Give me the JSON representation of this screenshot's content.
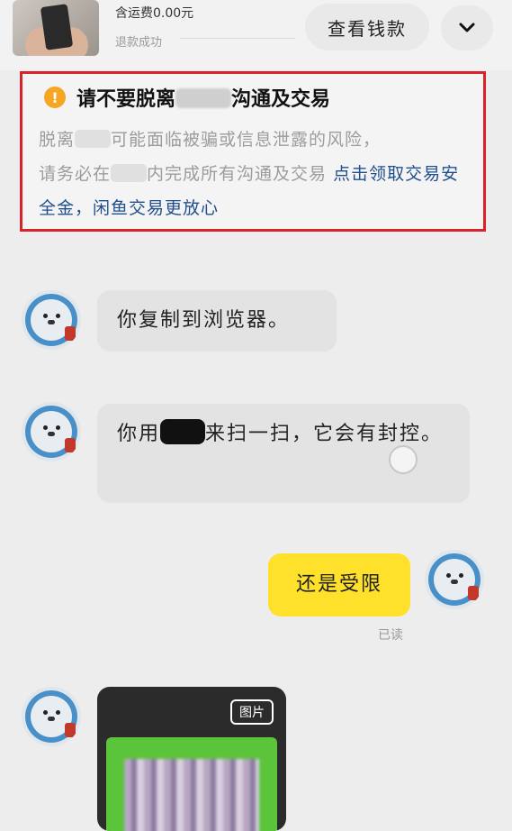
{
  "order": {
    "price_text": "含运费0.00元",
    "refund_status": "退款成功",
    "view_refund_label": "查看钱款"
  },
  "warning": {
    "title_before": "请不要脱离",
    "title_after": "沟通及交易",
    "line1_before": "脱离",
    "line1_after": "可能面临被骗或信息泄露的风险，",
    "line2_before": "请务必在",
    "line2_after": "内完成所有沟通及交易",
    "link_text": "点击领取交易安全金，闲鱼交易更放心"
  },
  "messages": [
    {
      "text": "你复制到浏览器。"
    },
    {
      "text_before": "你用",
      "text_after": "来扫一扫，它会有封控。"
    },
    {
      "text": "还是受限",
      "status": "已读"
    },
    {
      "image_tag": "图片"
    }
  ],
  "colors": {
    "warning_border": "#d8232a",
    "my_bubble": "#ffe12b",
    "link": "#1f4f8f"
  }
}
